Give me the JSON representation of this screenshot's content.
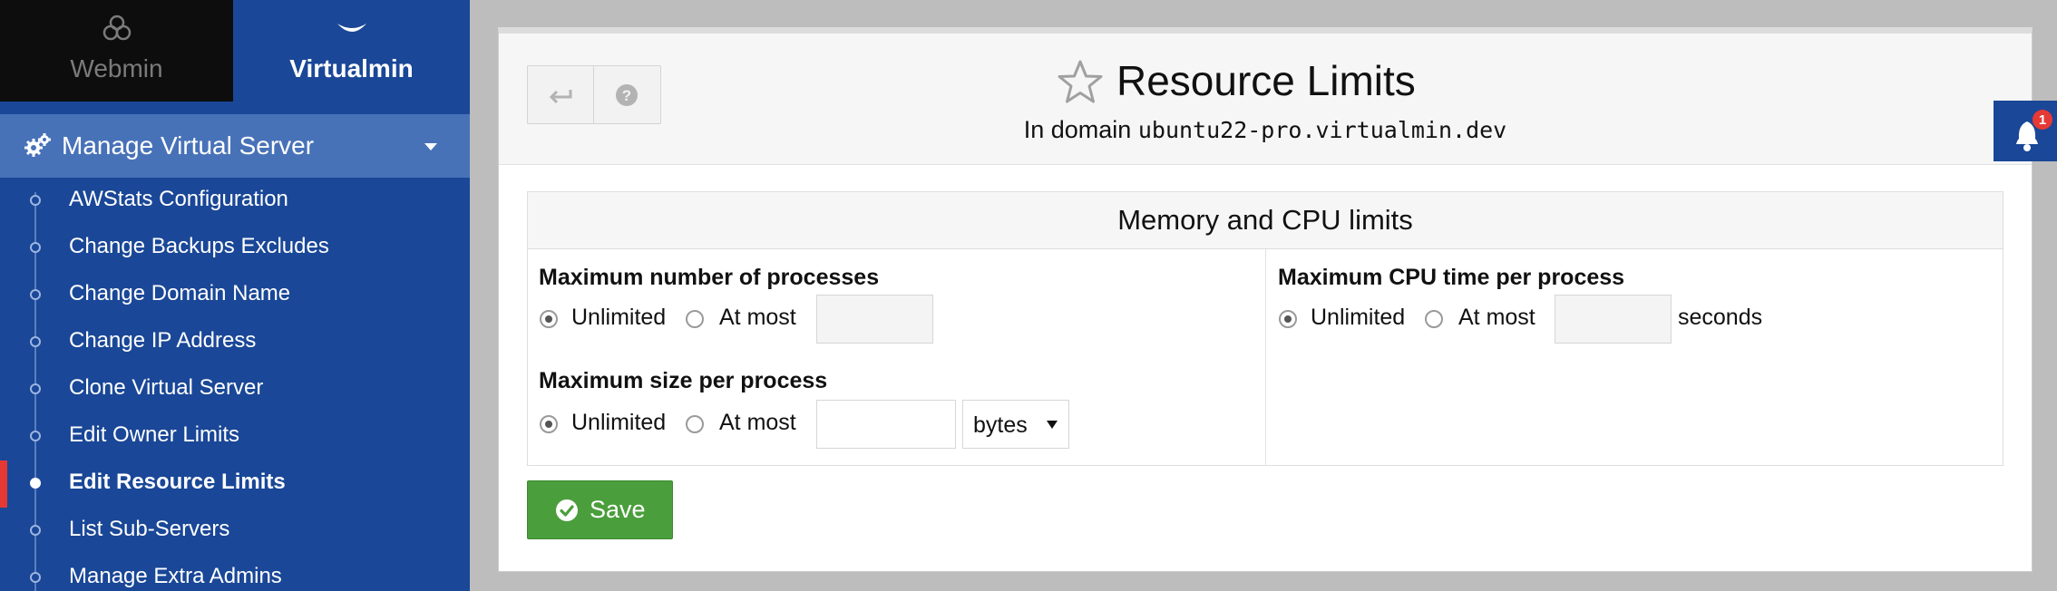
{
  "switcher": {
    "webmin_label": "Webmin",
    "virtualmin_label": "Virtualmin"
  },
  "menu": {
    "section_label": "Manage Virtual Server",
    "items": [
      {
        "label": "AWStats Configuration",
        "active": false
      },
      {
        "label": "Change Backups Excludes",
        "active": false
      },
      {
        "label": "Change Domain Name",
        "active": false
      },
      {
        "label": "Change IP Address",
        "active": false
      },
      {
        "label": "Clone Virtual Server",
        "active": false
      },
      {
        "label": "Edit Owner Limits",
        "active": false
      },
      {
        "label": "Edit Resource Limits",
        "active": true
      },
      {
        "label": "List Sub-Servers",
        "active": false
      },
      {
        "label": "Manage Extra Admins",
        "active": false
      }
    ]
  },
  "page": {
    "title": "Resource Limits",
    "subtitle_prefix": "In domain",
    "domain": "ubuntu22-pro.virtualmin.dev"
  },
  "notifications": {
    "count": "1"
  },
  "limits": {
    "heading": "Memory and CPU limits",
    "max_processes": {
      "label": "Maximum number of processes",
      "unlimited_label": "Unlimited",
      "atmost_label": "At most",
      "value": "",
      "selected": "unlimited"
    },
    "max_size": {
      "label": "Maximum size per process",
      "unlimited_label": "Unlimited",
      "atmost_label": "At most",
      "value": "",
      "unit": "bytes",
      "selected": "unlimited"
    },
    "max_cpu": {
      "label": "Maximum CPU time per process",
      "unlimited_label": "Unlimited",
      "atmost_label": "At most",
      "value": "",
      "unit_label": "seconds",
      "selected": "unlimited"
    }
  },
  "actions": {
    "save_label": "Save"
  },
  "colors": {
    "sidebar": "#1a4797",
    "manage_bar": "#4872b8",
    "save": "#4a9e3b",
    "active_marker": "#e53935"
  }
}
